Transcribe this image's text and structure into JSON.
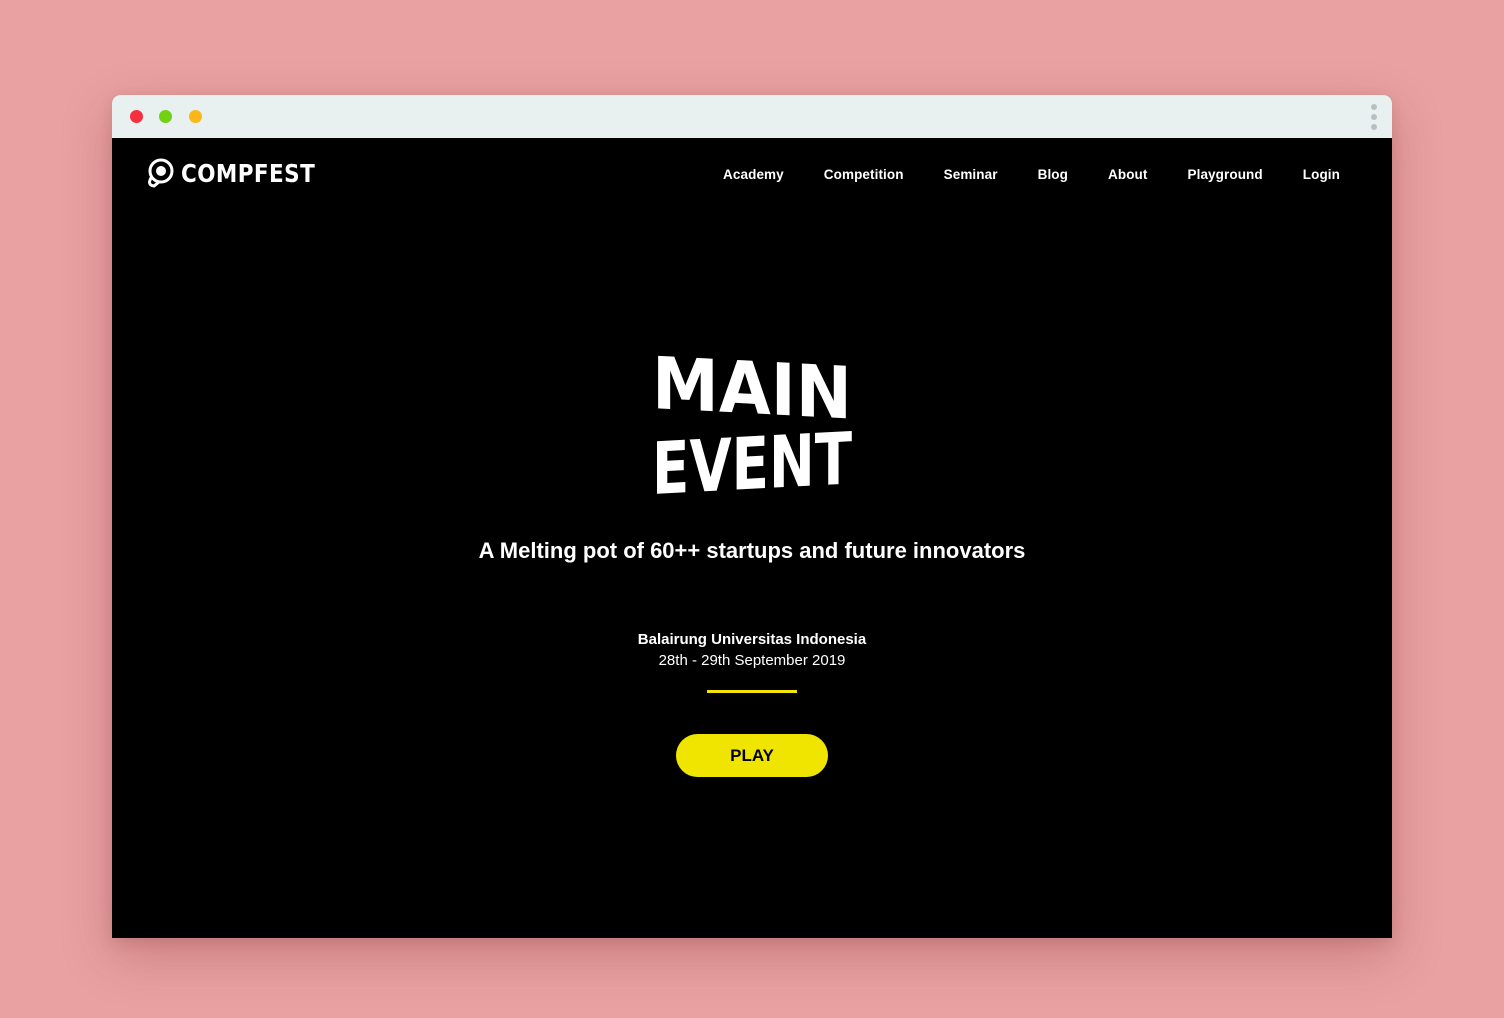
{
  "window": {
    "controls": [
      "close",
      "minimize",
      "maximize"
    ],
    "menu_icon": "kebab-menu-icon"
  },
  "header": {
    "logo_text": "COMPFEST",
    "logo_icon": "compfest-logo-icon",
    "nav": [
      {
        "label": "Academy"
      },
      {
        "label": "Competition"
      },
      {
        "label": "Seminar"
      },
      {
        "label": "Blog"
      },
      {
        "label": "About"
      },
      {
        "label": "Playground"
      },
      {
        "label": "Login"
      }
    ]
  },
  "hero": {
    "title_line1": "MAIN",
    "title_line2": "EVENT",
    "tagline": "A Melting pot of 60++ startups and future innovators",
    "venue": "Balairung Universitas Indonesia",
    "dates": "28th - 29th September 2019",
    "cta_label": "PLAY"
  },
  "colors": {
    "background": "#e9a1a2",
    "page": "#000000",
    "accent": "#f0e500",
    "text": "#ffffff"
  }
}
